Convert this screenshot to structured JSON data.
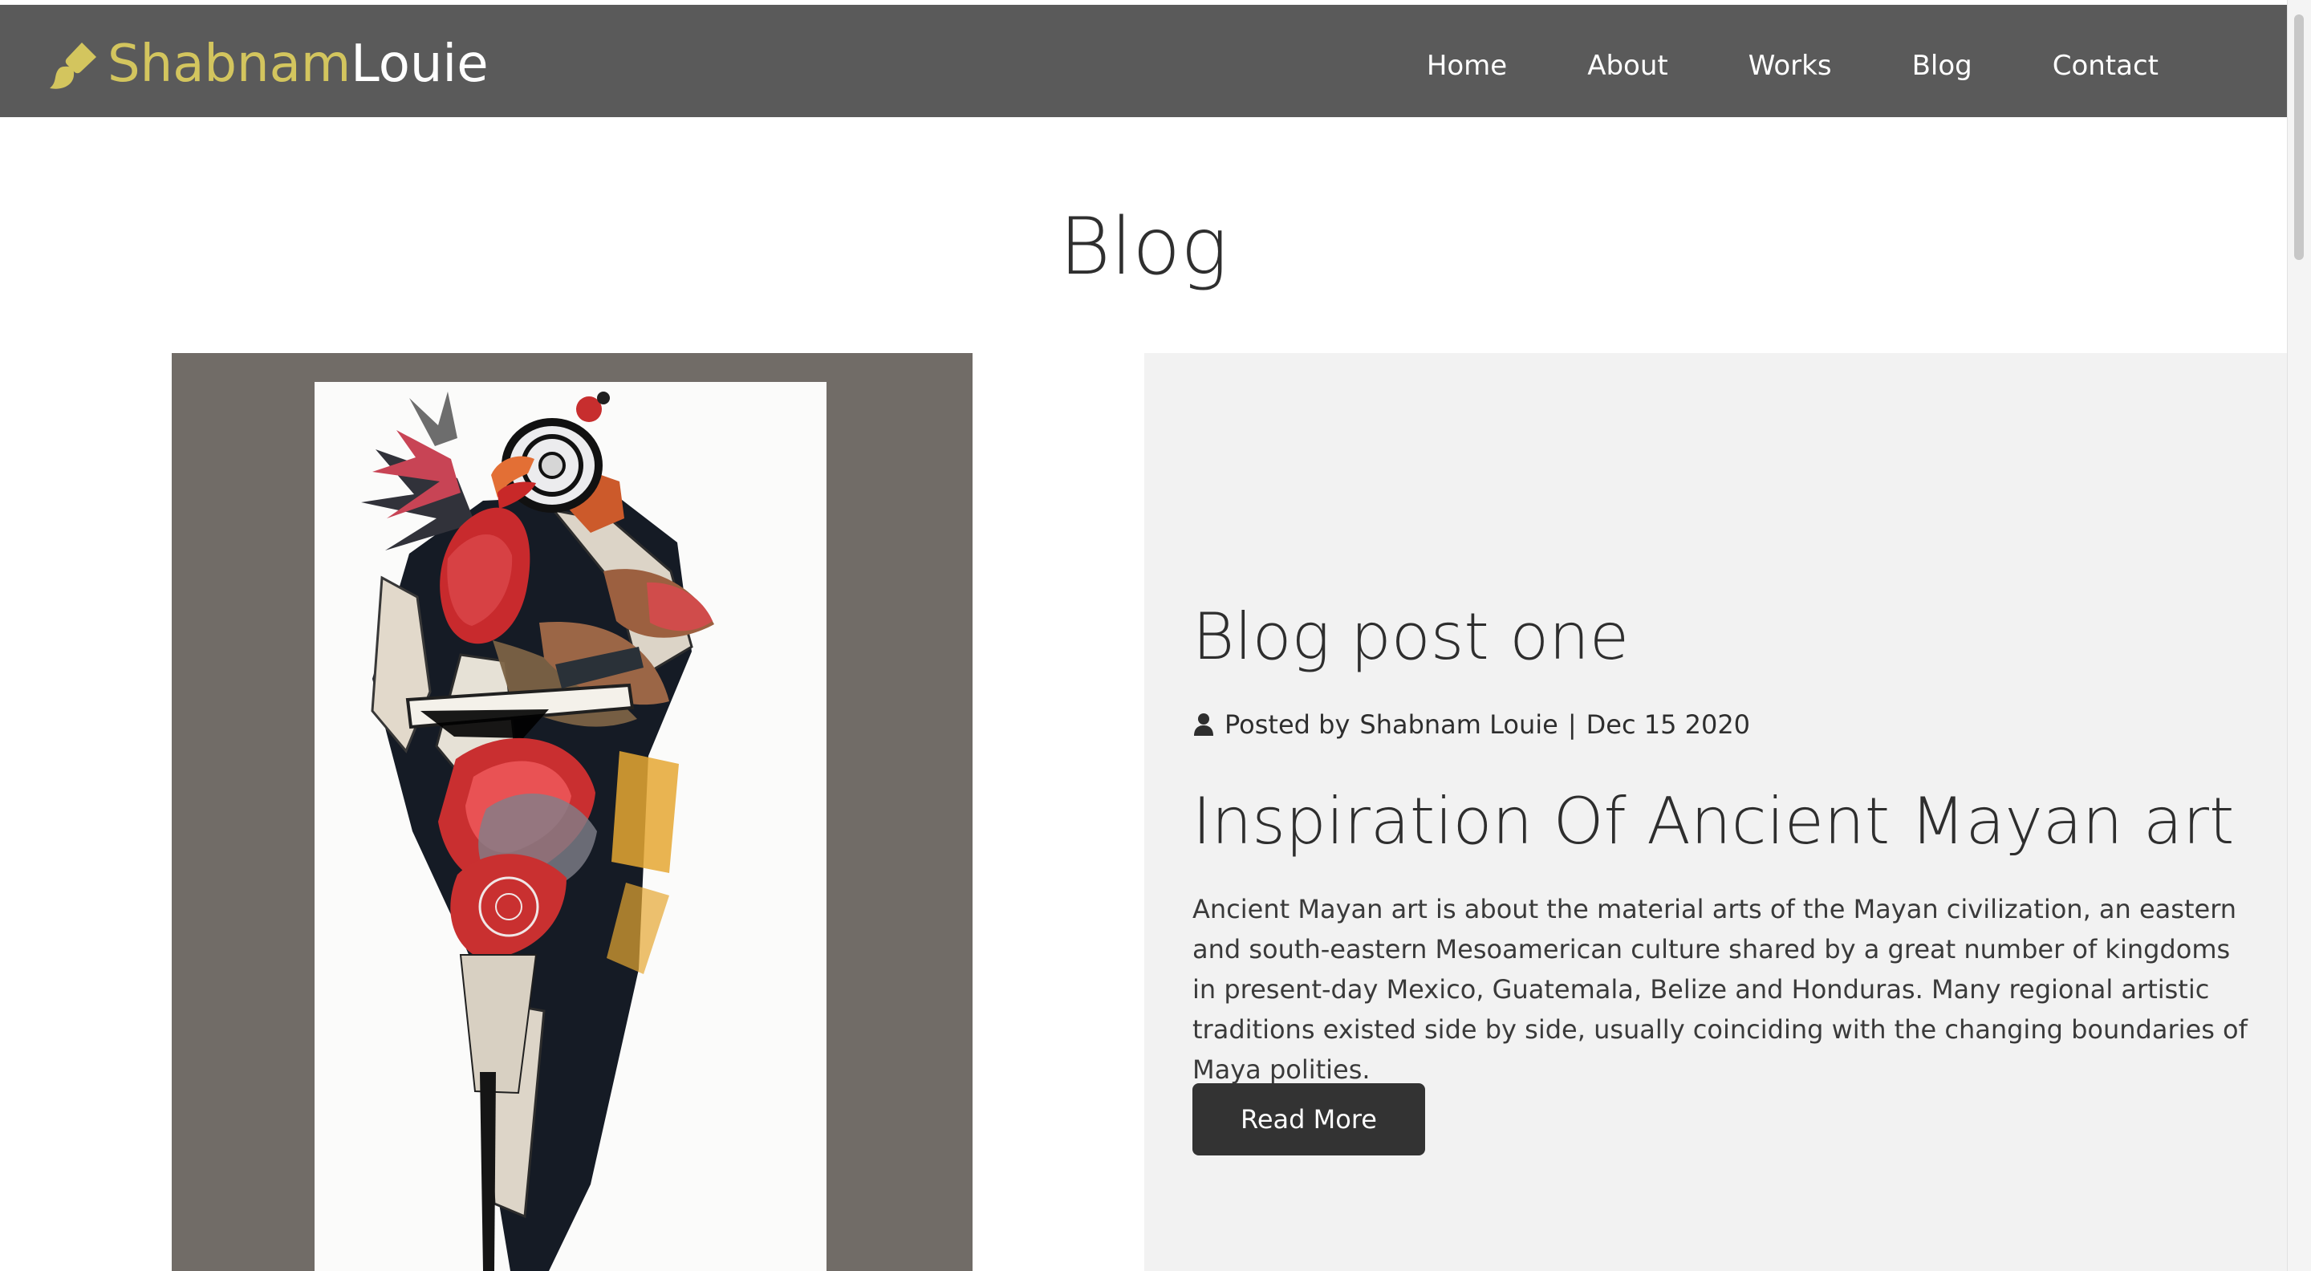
{
  "colors": {
    "nav_bg": "#5a5a5a",
    "brand_accent": "#d3c55e",
    "image_frame": "#716c67",
    "post_card_bg": "#f2f2f2",
    "button_bg": "#333333"
  },
  "header": {
    "brand": {
      "first": "Shabnam",
      "last": "Louie",
      "icon": "paintbrush-icon"
    },
    "nav": [
      {
        "label": "Home"
      },
      {
        "label": "About"
      },
      {
        "label": "Works"
      },
      {
        "label": "Blog"
      },
      {
        "label": "Contact"
      }
    ]
  },
  "page": {
    "title": "Blog"
  },
  "post": {
    "title": "Blog post one",
    "meta": {
      "icon": "user-icon",
      "prefix": "Posted by",
      "author": "Shabnam Louie",
      "separator": "|",
      "date": "Dec 15 2020"
    },
    "subtitle": "Inspiration Of Ancient Mayan art",
    "excerpt": "Ancient Mayan art is about the material arts of the Mayan civilization, an eastern and south-eastern Mesoamerican culture shared by a great number of kingdoms in present-day Mexico, Guatemala, Belize and Honduras. Many regional artistic traditions existed side by side, usually coinciding with the changing boundaries of Maya polities.",
    "button_label": "Read More"
  }
}
